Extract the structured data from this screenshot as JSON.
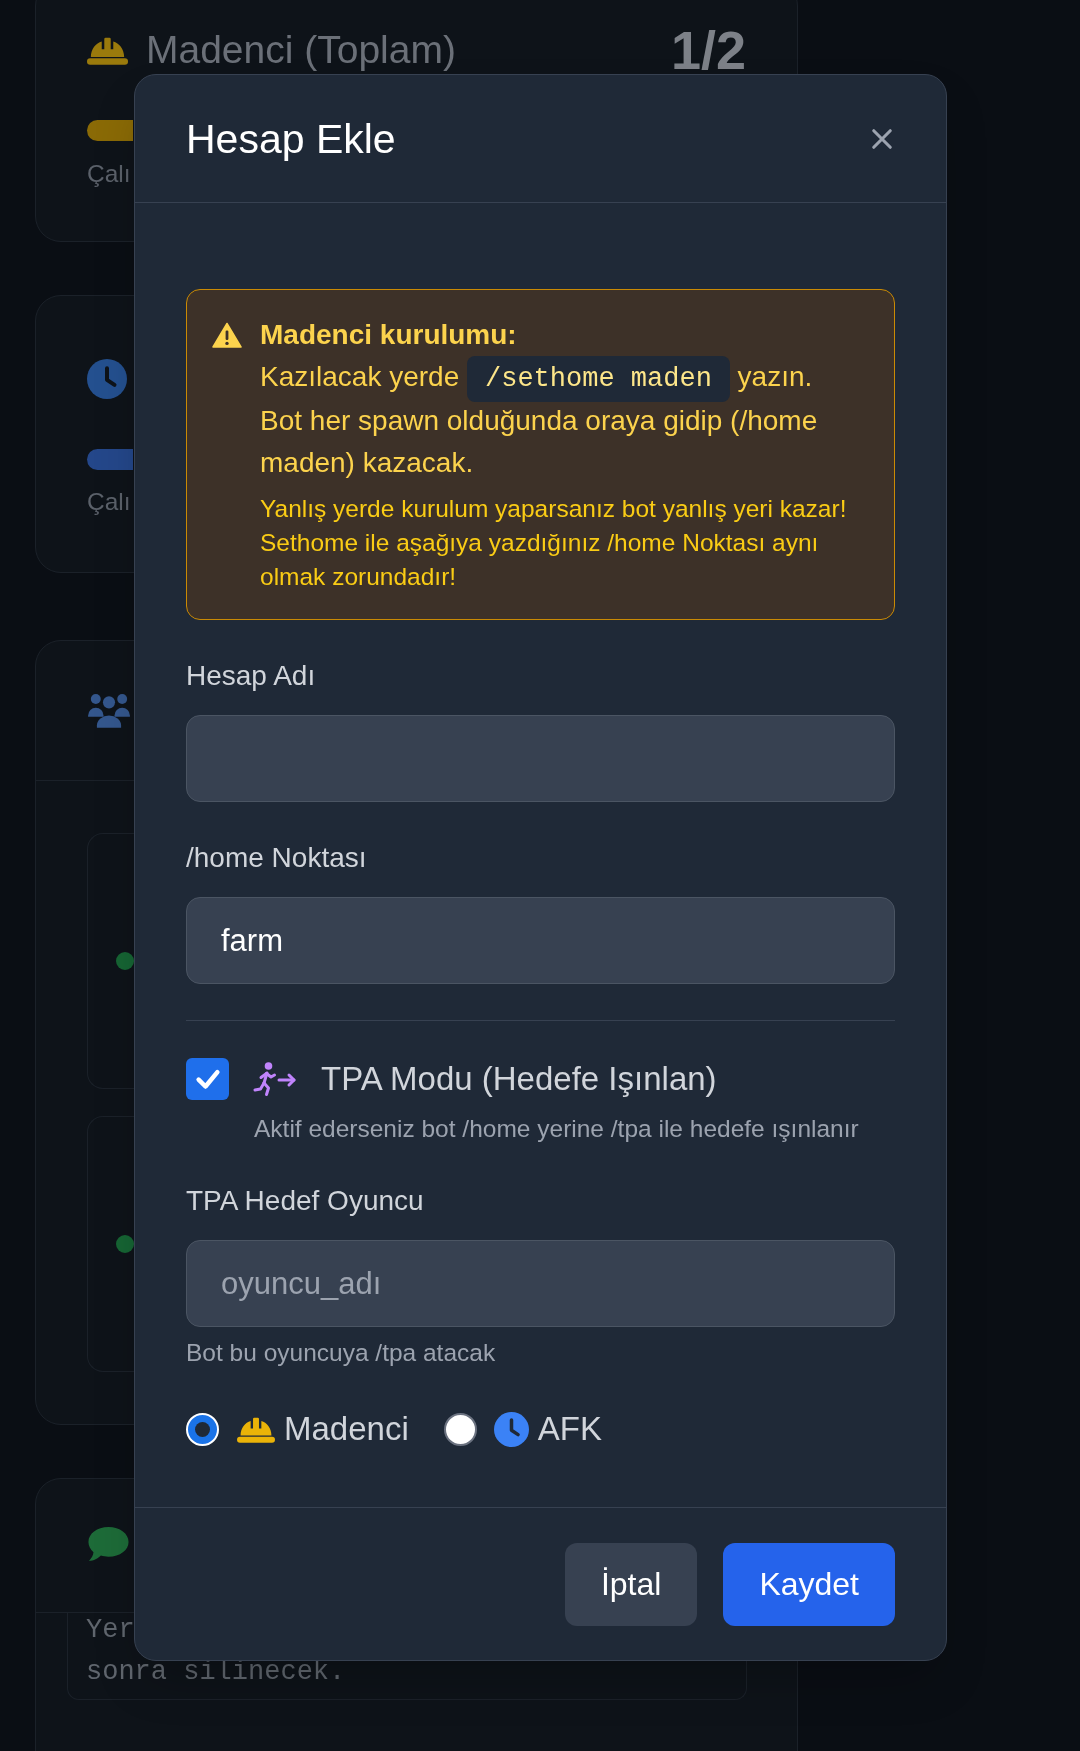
{
  "background": {
    "cards": [
      {
        "kind": "miner",
        "title": "Madenci (Toplam)",
        "count": "1/2",
        "color": "#8a6a06",
        "caption": "Çalı"
      },
      {
        "kind": "afk",
        "color": "#24478a",
        "caption": "Çalı"
      },
      {
        "kind": "accounts",
        "accounts": [
          {
            "color": "#166534"
          },
          {
            "color": "#166534"
          }
        ]
      },
      {
        "kind": "log",
        "lines": [
          "Yer",
          "sonra silinecek."
        ]
      }
    ]
  },
  "dialog": {
    "title": "Hesap Ekle",
    "warning": {
      "title": "Madenci kurulumu:",
      "text_before": "Kazılacak yerde",
      "code": "/sethome maden",
      "text_after": "yazın. Bot her spawn olduğunda oraya gidip (/home maden) kazacak.",
      "note": "Yanlış yerde kurulum yaparsanız bot yanlış yeri kazar! Sethome ile aşağıya yazdığınız /home Noktası aynı olmak zorundadır!"
    },
    "account_name": {
      "label": "Hesap Adı"
    },
    "home_point": {
      "label": "/home Noktası",
      "value": "farm"
    },
    "tpa_mode": {
      "label": "TPA Modu (Hedefe Işınlan)",
      "checked": true,
      "description": "Aktif ederseniz bot /home yerine /tpa ile hedefe ışınlanır"
    },
    "tpa_target": {
      "label": "TPA Hedef Oyuncu",
      "placeholder": "oyuncu_adı",
      "hint": "Bot bu oyuncuya /tpa atacak"
    },
    "roles": [
      {
        "kind": "miner",
        "label": "Madenci",
        "selected": true
      },
      {
        "kind": "afk",
        "label": "AFK",
        "selected": false
      }
    ],
    "buttons": [
      {
        "kind": "secondary",
        "label": "İptal"
      },
      {
        "kind": "primary",
        "label": "Kaydet"
      }
    ]
  }
}
